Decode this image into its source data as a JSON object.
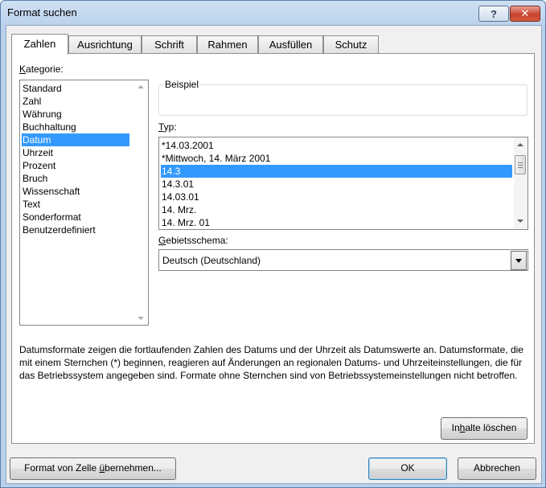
{
  "window": {
    "title": "Format suchen"
  },
  "tabs": [
    {
      "label": "Zahlen",
      "active": true
    },
    {
      "label": "Ausrichtung",
      "active": false
    },
    {
      "label": "Schrift",
      "active": false
    },
    {
      "label": "Rahmen",
      "active": false
    },
    {
      "label": "Ausfüllen",
      "active": false
    },
    {
      "label": "Schutz",
      "active": false
    }
  ],
  "category": {
    "label_first": "K",
    "label_rest": "ategorie:",
    "items": [
      "Standard",
      "Zahl",
      "Währung",
      "Buchhaltung",
      "Datum",
      "Uhrzeit",
      "Prozent",
      "Bruch",
      "Wissenschaft",
      "Text",
      "Sonderformat",
      "Benutzerdefiniert"
    ],
    "selected": "Datum"
  },
  "sample": {
    "label": "Beispiel",
    "value": ""
  },
  "type": {
    "label_first": "T",
    "label_rest": "yp:",
    "items": [
      "*14.03.2001",
      "*Mittwoch, 14. März 2001",
      "14.3",
      "14.3.01",
      "14.03.01",
      "14. Mrz.",
      "14. Mrz. 01"
    ],
    "selected": "14.3"
  },
  "locale": {
    "label_first": "G",
    "label_rest": "ebietsschema:",
    "selected_value": "Deutsch (Deutschland)"
  },
  "description": "Datumsformate zeigen die fortlaufenden Zahlen des Datums und der Uhrzeit als Datumswerte an. Datumsformate, die mit einem Sternchen (*) beginnen, reagieren auf Änderungen an regionalen Datums- und Uhrzeiteinstellungen, die für das Betriebssystem angegeben sind. Formate ohne Sternchen sind von Betriebssystemeinstellungen nicht betroffen.",
  "buttons": {
    "clear_pre": "In",
    "clear_u": "h",
    "clear_post": "alte löschen",
    "from_cell_pre": "Format von Zelle ",
    "from_cell_u": "ü",
    "from_cell_post": "bernehmen...",
    "ok": "OK",
    "cancel": "Abbrechen"
  },
  "colors": {
    "selection": "#3399ff",
    "titlebar": "#bcd3ee",
    "close": "#c8452f"
  }
}
